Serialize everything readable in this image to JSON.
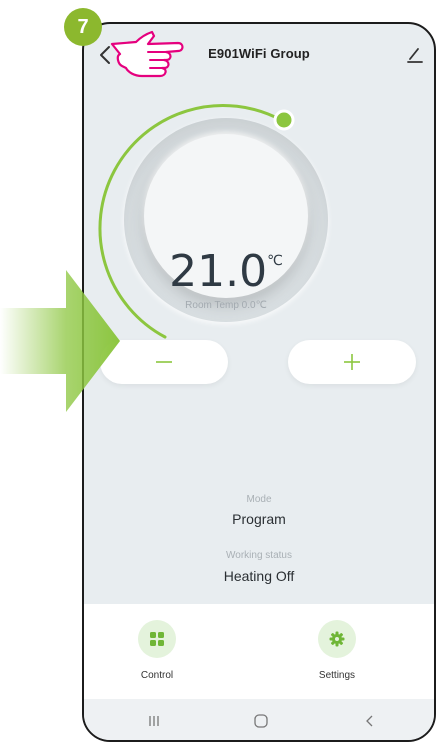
{
  "header": {
    "title": "E901WiFi Group"
  },
  "dial": {
    "temperature": "21.0",
    "unit": "℃",
    "room_temp": "Room Temp 0.0℃"
  },
  "controls": {
    "minus_label": "—",
    "plus_label": "+"
  },
  "mode": {
    "label": "Mode",
    "value": "Program"
  },
  "working_status": {
    "label": "Working status",
    "value": "Heating Off"
  },
  "tabs": [
    {
      "label": "Control",
      "icon": "grid-icon"
    },
    {
      "label": "Settings",
      "icon": "gear-icon"
    }
  ],
  "annotations": {
    "step_number": "7"
  },
  "colors": {
    "accent": "#8cc63f",
    "badge": "#8cb82e",
    "hand": "#e5007e",
    "background": "#e8edf0"
  }
}
